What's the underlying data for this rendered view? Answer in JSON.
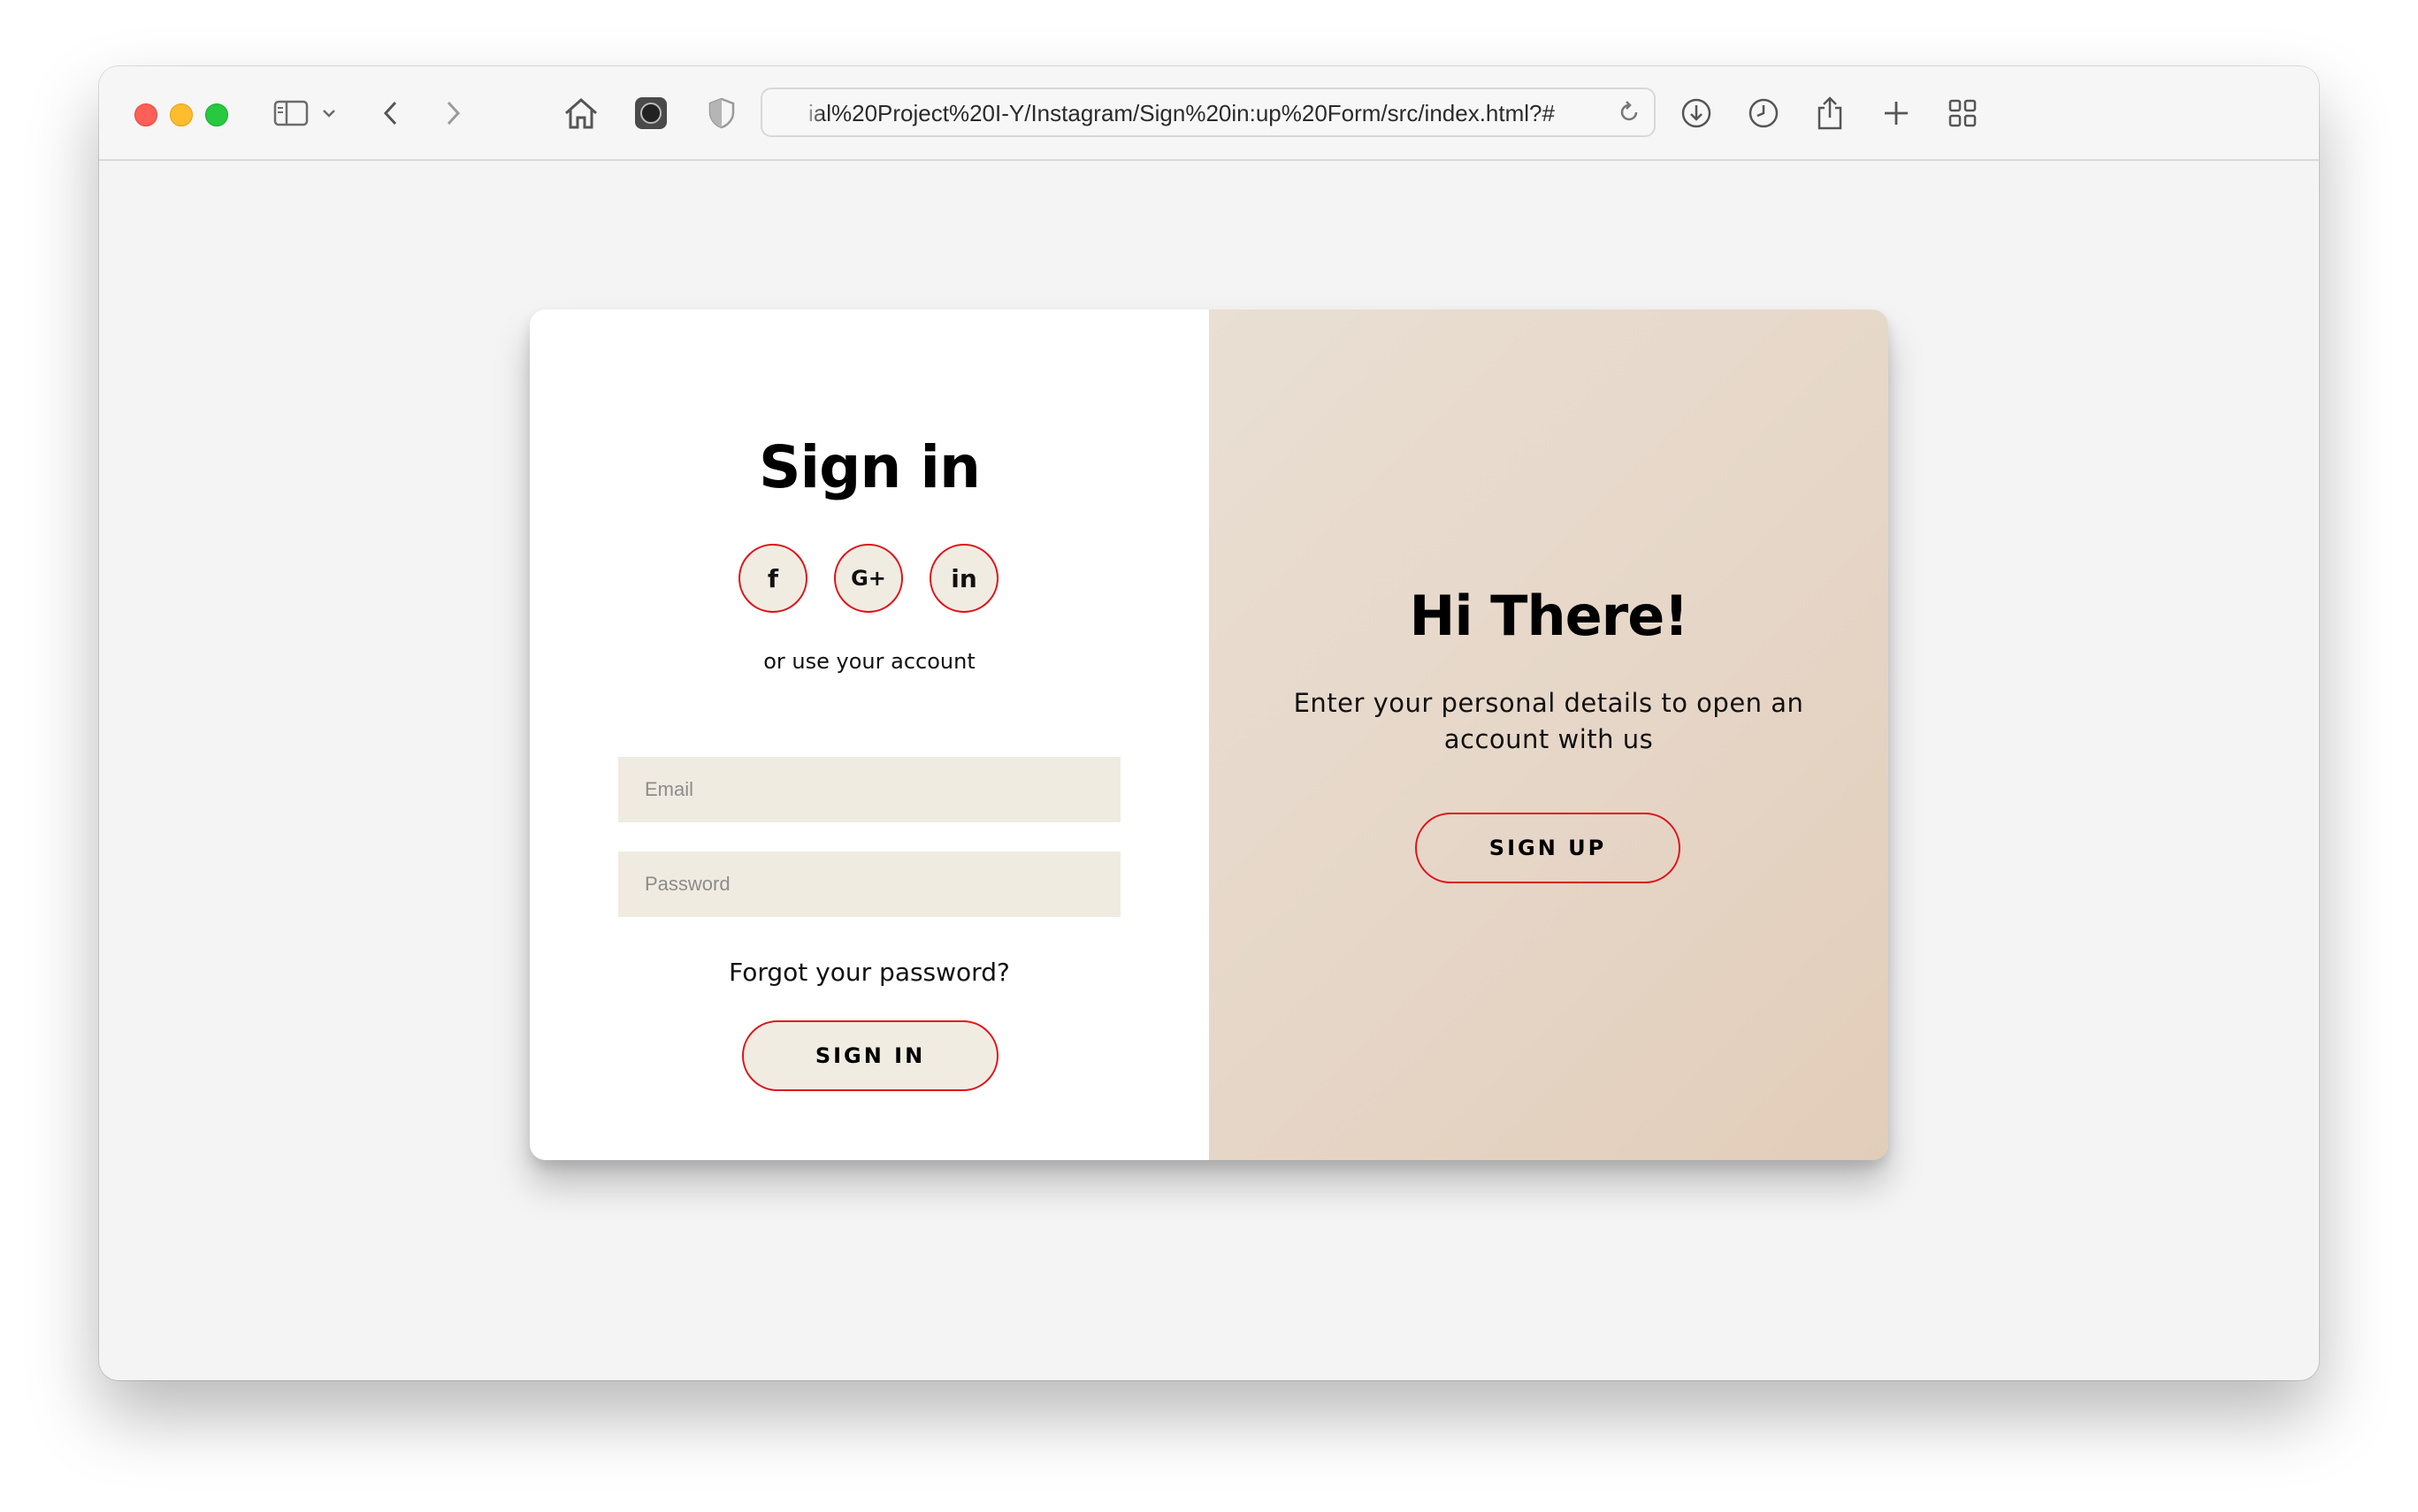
{
  "browser": {
    "url": "ial%20Project%20I-Y/Instagram/Sign%20in:up%20Form/src/index.html?#"
  },
  "signin_panel": {
    "title": "Sign in",
    "social": {
      "facebook_glyph": "f",
      "google_glyph": "G+",
      "linkedin_glyph": "in"
    },
    "alt_text": "or use your account",
    "email_placeholder": "Email",
    "password_placeholder": "Password",
    "forgot_link": "Forgot your password?",
    "button_label": "SIGN IN"
  },
  "overlay_panel": {
    "title": "Hi There!",
    "text": "Enter your personal details to open an account with us",
    "button_label": "SIGN UP"
  },
  "colors": {
    "accent_border": "#e0121a",
    "input_bg": "#f0ebe0",
    "overlay_bg": "#e6d6c7"
  }
}
